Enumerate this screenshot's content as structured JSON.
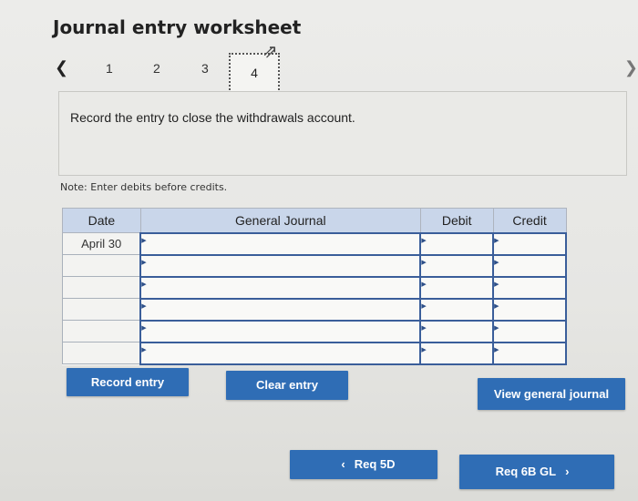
{
  "page": {
    "title": "Journal entry worksheet"
  },
  "steps": {
    "prev_icon": "chevron-left-icon",
    "next_icon": "chevron-right-icon",
    "items": [
      "1",
      "2",
      "3",
      "4"
    ],
    "current": "4"
  },
  "instruction": {
    "text": "Record the entry to close the withdrawals account."
  },
  "note": "Note: Enter debits before credits.",
  "journal": {
    "headers": {
      "date": "Date",
      "account": "General Journal",
      "debit": "Debit",
      "credit": "Credit"
    },
    "rows": [
      {
        "date": "April 30",
        "account": "",
        "debit": "",
        "credit": ""
      },
      {
        "date": "",
        "account": "",
        "debit": "",
        "credit": ""
      },
      {
        "date": "",
        "account": "",
        "debit": "",
        "credit": ""
      },
      {
        "date": "",
        "account": "",
        "debit": "",
        "credit": ""
      },
      {
        "date": "",
        "account": "",
        "debit": "",
        "credit": ""
      },
      {
        "date": "",
        "account": "",
        "debit": "",
        "credit": ""
      }
    ]
  },
  "buttons": {
    "record": "Record entry",
    "clear": "Clear entry",
    "view": "View general journal",
    "prev": "Req 5D",
    "next": "Req 6B GL"
  },
  "colors": {
    "button_bg": "#2f6db5",
    "header_bg": "#c9d6ea",
    "cell_border": "#3a5e9a"
  }
}
